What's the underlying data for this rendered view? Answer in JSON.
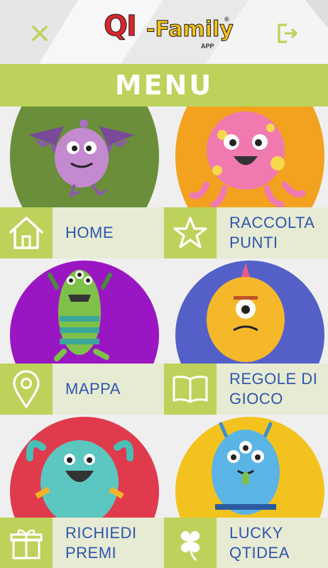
{
  "header": {
    "logo_qi": "QI",
    "logo_family": "-Family",
    "logo_app": "APP",
    "logo_registered": "®",
    "close_icon": "close-icon",
    "logout_icon": "logout-icon"
  },
  "menu_title": "MENU",
  "colors": {
    "accent_green": "#bcd25a",
    "label_bg": "#e7ebd3",
    "label_text": "#2f56b0"
  },
  "tiles": [
    {
      "label_line1": "HOME",
      "label_line2": "",
      "icon": "home-icon",
      "circle_color": "#6a8e3a",
      "monster": "purple-bat-monster"
    },
    {
      "label_line1": "RACCOLTA",
      "label_line2": "PUNTI",
      "icon": "star-icon",
      "circle_color": "#f3a21f",
      "monster": "pink-octopus-monster"
    },
    {
      "label_line1": "MAPPA",
      "label_line2": "",
      "icon": "map-pin-icon",
      "circle_color": "#9a16c3",
      "monster": "green-striped-monster"
    },
    {
      "label_line1": "REGOLE DI",
      "label_line2": "GIOCO",
      "icon": "open-book-icon",
      "circle_color": "#5460c8",
      "monster": "orange-cyclops-monster"
    },
    {
      "label_line1": "RICHIEDI",
      "label_line2": "PREMI",
      "icon": "gift-icon",
      "circle_color": "#e03b4c",
      "monster": "teal-horned-monster"
    },
    {
      "label_line1": "LUCKY",
      "label_line2": "QTIDEA",
      "icon": "clover-icon",
      "circle_color": "#f3c21f",
      "monster": "blue-three-eyed-monster"
    }
  ]
}
